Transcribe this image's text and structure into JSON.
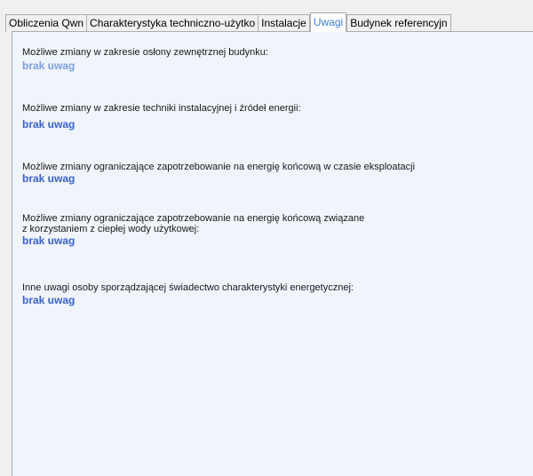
{
  "tabs": [
    {
      "label": "Obliczenia Qwn",
      "active": false
    },
    {
      "label": "Charakterystyka techniczno-użytko",
      "active": false
    },
    {
      "label": "Instalacje",
      "active": false
    },
    {
      "label": "Uwagi",
      "active": true
    },
    {
      "label": "Budynek referencyjn",
      "active": false
    }
  ],
  "sections": [
    {
      "label": "Możliwe zmiany w zakresie osłony zewnętrznej budynku:",
      "value": "brak uwag"
    },
    {
      "label": "Możliwe zmiany w zakresie techniki instalacyjnej i źródeł energii:",
      "value": "brak uwag"
    },
    {
      "label": "Możliwe zmiany ograniczające zapotrzebowanie na energię końcową w czasie eksploatacji",
      "value": "brak uwag"
    },
    {
      "label_line1": "Możliwe zmiany ograniczające zapotrzebowanie na energię końcową związane",
      "label_line2": "z korzystaniem z ciepłej wody użytkowej:",
      "value": "brak uwag"
    },
    {
      "label": "Inne uwagi osoby sporządzającej świadectwo charakterystyki energetycznej:",
      "value": "brak uwag"
    }
  ],
  "colors": {
    "active_tab_text": "#3b7dd8",
    "value_text": "#3a62c8",
    "panel_background": "#f0f4fb"
  }
}
